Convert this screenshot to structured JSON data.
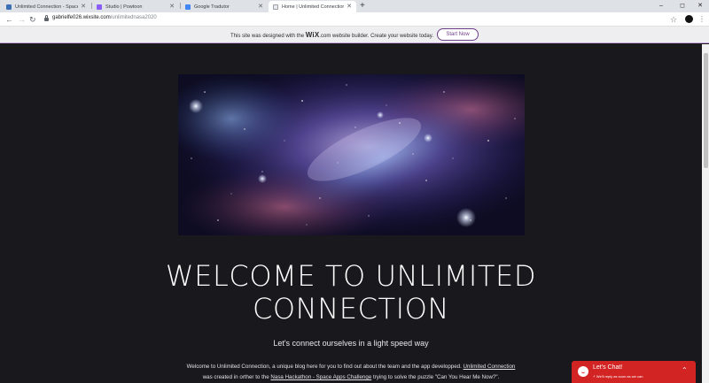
{
  "browser": {
    "tabs": [
      {
        "label": "Unlimited Connection - Space A",
        "favicon_color": "#3b6fb6",
        "active": false
      },
      {
        "label": "Studio | Powtoon",
        "favicon_color": "#8a5cf6",
        "active": false
      },
      {
        "label": "Google Tradutor",
        "favicon_color": "#4285f4",
        "active": false
      },
      {
        "label": "Home | Unlimited Connection",
        "favicon_color": "#e8eaed",
        "active": true
      }
    ],
    "new_tab": "+",
    "window_controls": {
      "minimize": "–",
      "maximize": "◻",
      "close": "✕"
    },
    "url_domain": "gabrielfe026.wixsite.com",
    "url_path": "/unlimitednasa2020"
  },
  "wix_banner": {
    "text_before": "This site was designed with the ",
    "brand": "WiX",
    "brand_suffix": ".com",
    "text_after": " website builder. Create your website today.",
    "button_label": "Start Now"
  },
  "page": {
    "heading_line1": "WELCOME TO UNLIMITED",
    "heading_line2": "CONNECTION",
    "subheading": "Let's connect ourselves in a light speed way",
    "body_1": "Welcome to Unlimited Connection, a unique blog here for you to find out about the team and the app developped. ",
    "body_link1": "Unlimited Connection",
    "body_2": "was created in orther to the ",
    "body_link2": "Nasa Hackathon - Space Apps Challenge",
    "body_3": " trying to solve the puzzle \"Can You Hear Me Now?\"."
  },
  "chat": {
    "title": "Let's Chat!",
    "note": "⚡ We'll reply as soon as we can",
    "accent": "#d32424"
  }
}
